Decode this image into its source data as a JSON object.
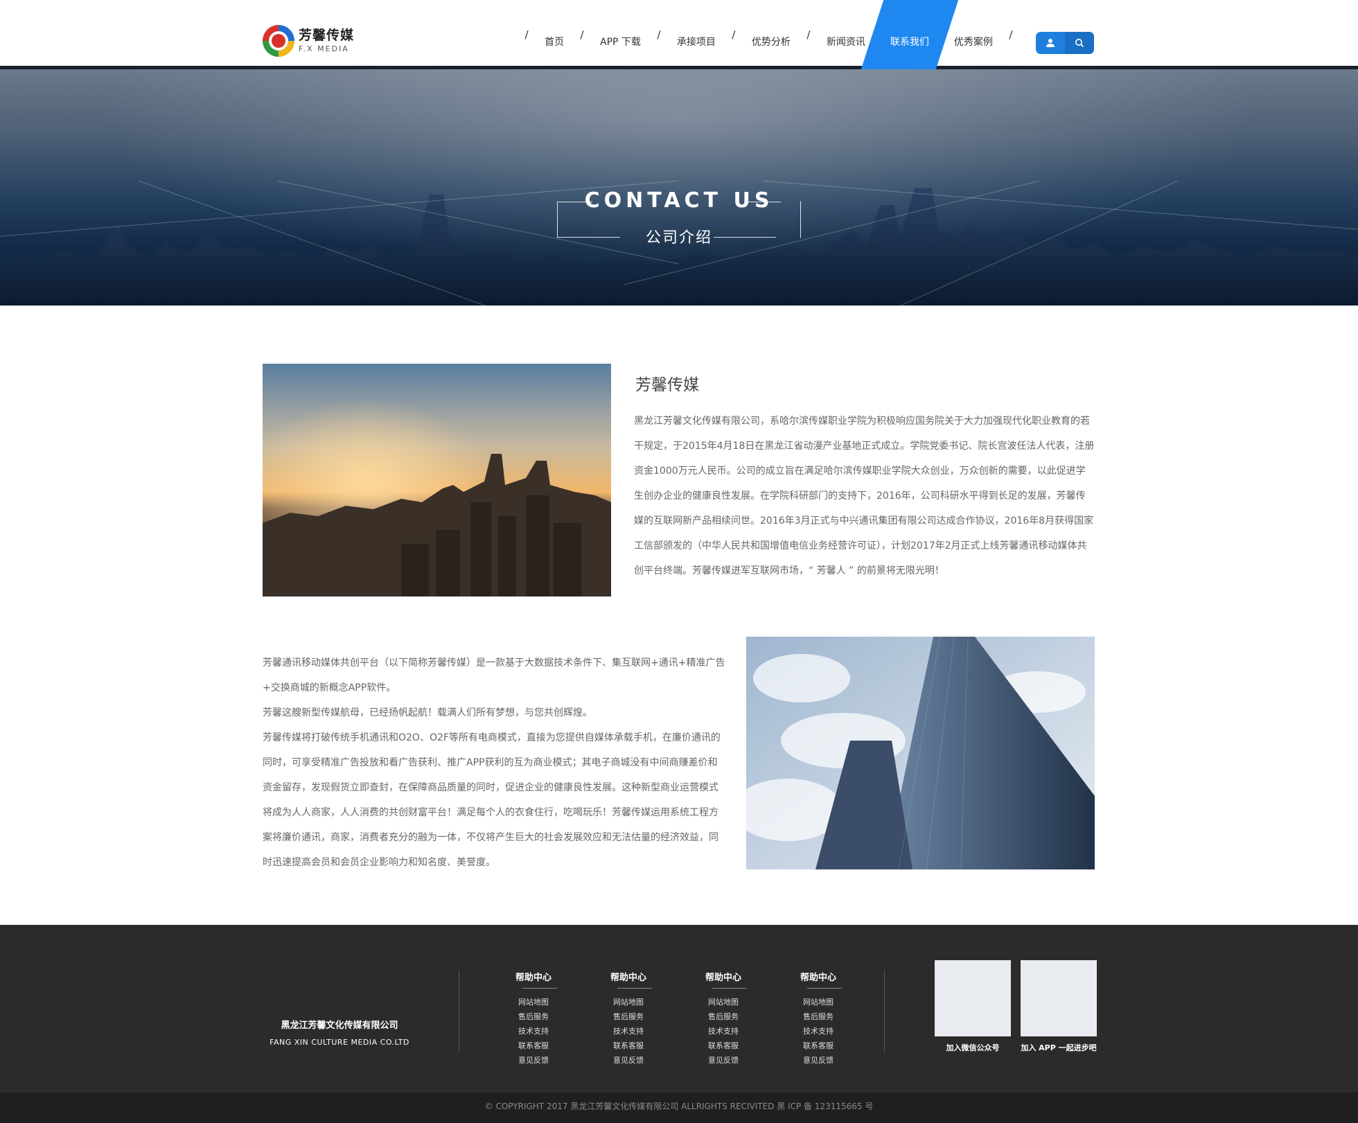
{
  "header": {
    "logo_cn": "芳馨传媒",
    "logo_en": "F.X MEDIA",
    "nav": [
      {
        "label": "首页"
      },
      {
        "label": "APP 下载"
      },
      {
        "label": "承接项目"
      },
      {
        "label": "优势分析"
      },
      {
        "label": "新闻资讯"
      },
      {
        "label": "联系我们",
        "active": true
      },
      {
        "label": "优秀案例"
      }
    ],
    "separator": "/"
  },
  "banner": {
    "title": "CONTACT US",
    "subtitle": "公司介绍"
  },
  "intro": {
    "title": "芳馨传媒",
    "paragraph": "黑龙江芳馨文化传媒有限公司，系哈尔滨传媒职业学院为积极响应国务院关于大力加强现代化职业教育的若干规定，于2015年4月18日在黑龙江省动漫产业基地正式成立。学院党委书记、院长宫波任法人代表，注册资金1000万元人民币。公司的成立旨在满足哈尔滨传媒职业学院大众创业，万众创新的需要，以此促进学生创办企业的健康良性发展。在学院科研部门的支持下，2016年，公司科研水平得到长足的发展，芳馨传媒的互联网新产品相续问世。2016年3月正式与中兴通讯集团有限公司达成合作协议，2016年8月获得国家工信部颁发的（中华人民共和国增值电信业务经营许可证），计划2017年2月正式上线芳馨通讯移动媒体共创平台终端。芳馨传媒进军互联网市场，“ 芳馨人 ” 的前景将无限光明！"
  },
  "platform": {
    "p1": "芳馨通讯移动媒体共创平台（以下简称芳馨传媒）是一款基于大数据技术条件下、集互联网+通讯+精准广告+交换商城的新概念APP软件。",
    "p2": "芳馨这艘新型传媒航母，已经扬帆起航！载满人们所有梦想，与您共创辉煌。",
    "p3": "芳馨传媒将打破传统手机通讯和O2O、O2F等所有电商模式，直接为您提供自媒体承载手机，在廉价通讯的同时，可享受精准广告投放和看广告获利、推广APP获利的互为商业模式；其电子商城没有中间商赚差价和资金留存，发现假货立即查封，在保障商品质量的同时，促进企业的健康良性发展。这种新型商业运营模式将成为人人商家，人人消费的共创财富平台！满足每个人的衣食住行，吃喝玩乐！芳馨传媒运用系统工程方案将廉价通讯，商家，消费者充分的融为一体，不仅将产生巨大的社会发展效应和无法估量的经济效益，同时迅速提高会员和会员企业影响力和知名度、美誉度。"
  },
  "footer": {
    "company_cn": "黑龙江芳馨文化传媒有限公司",
    "company_en": "FANG XIN CULTURE MEDIA CO.LTD",
    "help_columns": [
      {
        "title": "帮助中心",
        "links": [
          "网站地图",
          "售后服务",
          "技术支持",
          "联系客服",
          "意见反馈"
        ]
      },
      {
        "title": "帮助中心",
        "links": [
          "网站地图",
          "售后服务",
          "技术支持",
          "联系客服",
          "意见反馈"
        ]
      },
      {
        "title": "帮助中心",
        "links": [
          "网站地图",
          "售后服务",
          "技术支持",
          "联系客服",
          "意见反馈"
        ]
      },
      {
        "title": "帮助中心",
        "links": [
          "网站地图",
          "售后服务",
          "技术支持",
          "联系客服",
          "意见反馈"
        ]
      }
    ],
    "qr_wechat_label": "加入微信公众号",
    "qr_app_label": "加入 APP 一起进步吧",
    "copyright": "© COPYRIGHT 2017 黑龙江芳馨文化传媒有限公司 ALLRIGHTS RECIVITED 黑 ICP 备 123115665 号"
  },
  "icons": {
    "user": "user-icon",
    "search": "search-icon"
  },
  "colors": {
    "accent": "#1f88f0",
    "footer_bg": "#2b2b2b",
    "copyright_bg": "#1f1f1f"
  }
}
